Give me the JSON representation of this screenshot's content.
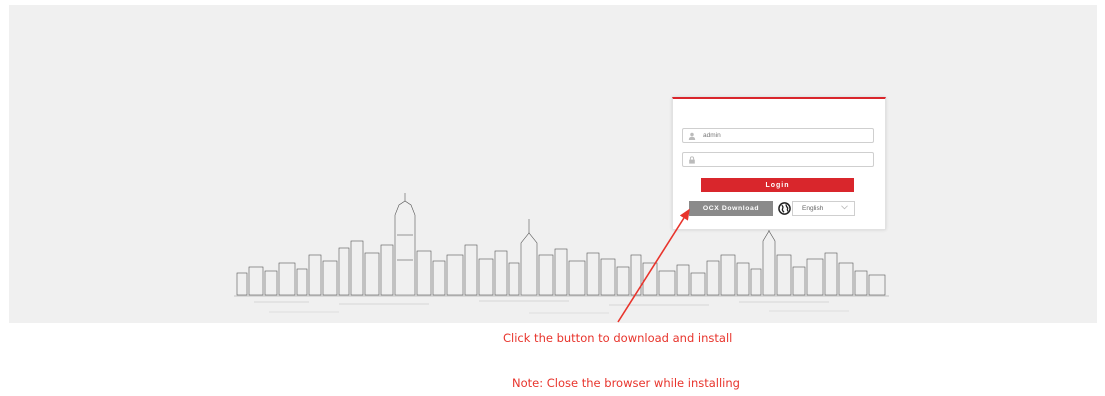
{
  "login": {
    "username_value": "admin",
    "password_value": "",
    "login_label": "Login",
    "ocx_download_label": "OCX Download",
    "language_selected": "English",
    "accent_color": "#d9262c",
    "ocx_button_color": "#8a8a8a"
  },
  "annotations": {
    "instruction": "Click the button to download and install",
    "note": "Note: Close the browser while installing",
    "color": "#e8342c"
  }
}
